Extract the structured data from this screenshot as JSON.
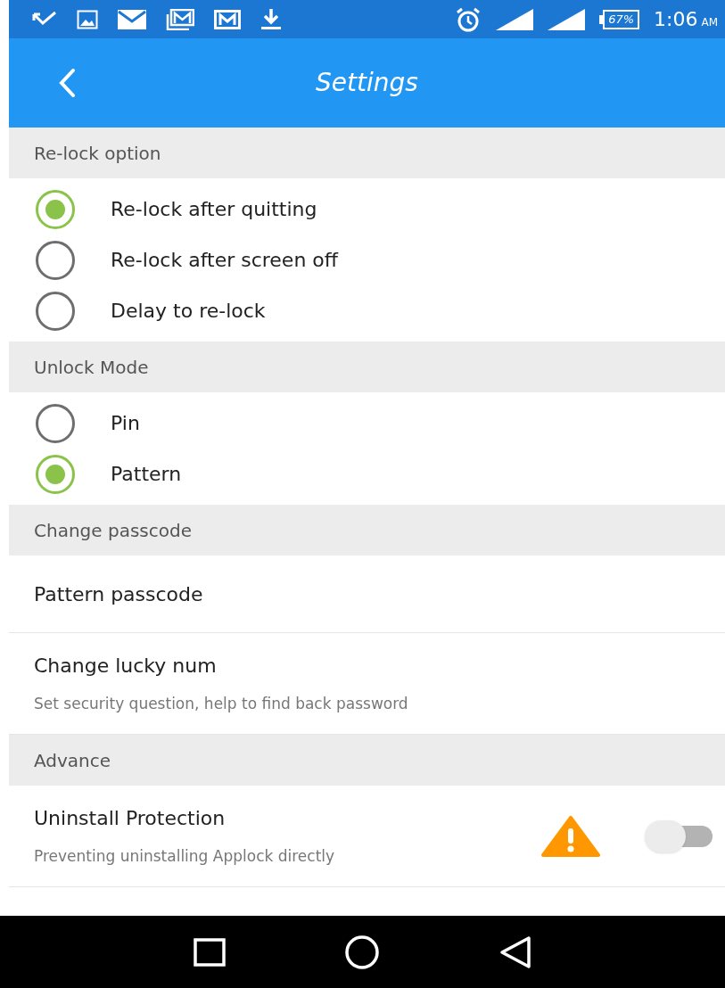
{
  "status_bar": {
    "battery": "67%",
    "time": "1:06",
    "ampm": "AM"
  },
  "app_bar": {
    "title": "Settings"
  },
  "sections": [
    {
      "header": "Re-lock option",
      "kind": "radio",
      "options": [
        {
          "label": "Re-lock after quitting",
          "selected": true
        },
        {
          "label": "Re-lock after screen off",
          "selected": false
        },
        {
          "label": "Delay to re-lock",
          "selected": false
        }
      ]
    },
    {
      "header": "Unlock Mode",
      "kind": "radio",
      "options": [
        {
          "label": "Pin",
          "selected": false
        },
        {
          "label": "Pattern",
          "selected": true
        }
      ]
    },
    {
      "header": "Change passcode",
      "kind": "list",
      "items": [
        {
          "title": "Pattern passcode"
        },
        {
          "title": "Change lucky num",
          "subtitle": "Set security question, help to find back password"
        }
      ]
    },
    {
      "header": "Advance",
      "kind": "list",
      "items": [
        {
          "title": "Uninstall Protection",
          "subtitle": "Preventing uninstalling Applock directly",
          "warning": true,
          "on": false
        }
      ]
    }
  ]
}
